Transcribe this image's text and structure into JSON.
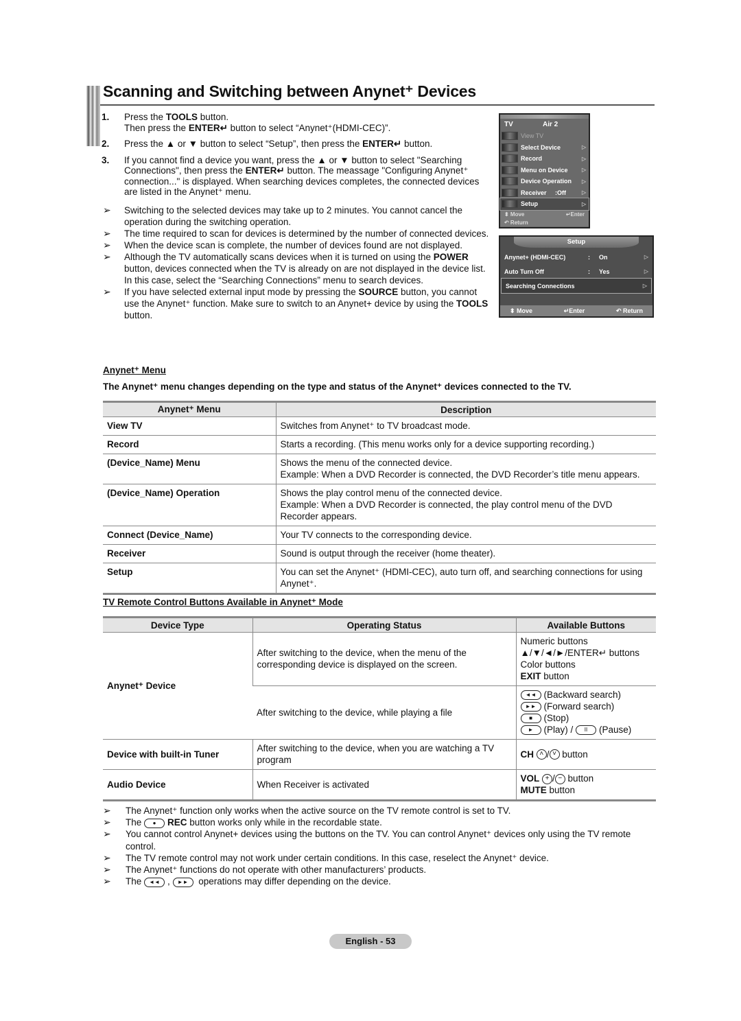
{
  "page": {
    "title": "Scanning and Switching between Anynet⁺ Devices",
    "page_number_label": "English - 53"
  },
  "steps": [
    {
      "num": "1.",
      "line1_pre": "Press the ",
      "line1_bold": "TOOLS",
      "line1_post": " button.",
      "line2_pre": "Then press the ",
      "line2_bold": "ENTER↵",
      "line2_post": " button to select “Anynet⁺(HDMI-CEC)”."
    },
    {
      "num": "2.",
      "pre": "Press the ▲ or ▼ button to select “Setup”, then press the ",
      "bold": "ENTER↵",
      "post": " button."
    },
    {
      "num": "3.",
      "pre": "If you cannot find a device you want, press the ▲ or ▼ button to select \"Searching Connections\", then press the ",
      "bold": "ENTER↵",
      "post": " button. The meassage \"Configuring Anynet⁺ connection...\" is displayed. When searching devices completes, the connected devices are listed in the Anynet⁺ menu."
    }
  ],
  "top_notes": [
    {
      "text": "Switching to the selected devices may take up to 2 minutes. You cannot cancel the operation during the switching operation."
    },
    {
      "text": "The time required to scan for devices is determined by the number of connected devices."
    },
    {
      "text": "When the device scan is complete, the number of devices found are not displayed."
    },
    {
      "pre": "Although the TV automatically scans devices when it is turned on using the ",
      "bold": "POWER",
      "post": " button, devices connected when the TV is already on are not displayed in the device list. In this case, select the “Searching Connections” menu to search devices."
    },
    {
      "pre": "If you have selected external input mode by pressing the ",
      "bold": "SOURCE",
      "post": " button, you cannot use the Anynet⁺ function. Make sure to switch to an Anynet+ device by using the ",
      "bold2": "TOOLS",
      "post2": " button."
    }
  ],
  "note_arrow": "➢",
  "osd_menu": {
    "source": "TV",
    "channel": "Air 2",
    "items": [
      {
        "label": "View TV",
        "dim": true
      },
      {
        "label": "Select Device"
      },
      {
        "label": "Record"
      },
      {
        "label": "Menu on Device"
      },
      {
        "label": "Device Operation"
      },
      {
        "label": "Receiver     :Off"
      },
      {
        "label": "Setup",
        "selected": true
      }
    ],
    "foot_move": "⬍ Move",
    "foot_enter": "↵Enter",
    "foot_return": "↶ Return"
  },
  "osd_setup": {
    "title": "Setup",
    "rows": [
      {
        "name": "Anynet+ (HDMI-CEC)",
        "colon": ":",
        "value": "On"
      },
      {
        "name": "Auto Turn Off",
        "colon": ":",
        "value": "Yes"
      },
      {
        "name": "Searching Connections",
        "colon": "",
        "value": "",
        "selected": true
      }
    ],
    "foot_move": "⬍ Move",
    "foot_enter": "↵Enter",
    "foot_return": "↶ Return"
  },
  "anynet_menu": {
    "heading": "Anynet⁺ Menu",
    "intro": "The Anynet⁺ menu changes depending on the type and status of the Anynet⁺ devices connected to the TV.",
    "columns": [
      "Anynet⁺ Menu",
      "Description"
    ],
    "rows": [
      {
        "menu": "View TV",
        "desc": [
          "Switches from Anynet⁺ to TV broadcast mode."
        ]
      },
      {
        "menu": "Record",
        "desc": [
          "Starts a recording. (This menu works only for a device supporting recording.)"
        ]
      },
      {
        "menu": "(Device_Name) Menu",
        "desc": [
          "Shows the menu of the connected device.",
          "Example: When a DVD Recorder is connected, the DVD Recorder’s title menu appears."
        ]
      },
      {
        "menu": "(Device_Name) Operation",
        "desc": [
          "Shows the play control menu of the connected device.",
          "Example: When a DVD Recorder is connected, the play control menu of the DVD Recorder appears."
        ]
      },
      {
        "menu": "Connect (Device_Name)",
        "desc": [
          "Your TV connects to the corresponding device."
        ]
      },
      {
        "menu": "Receiver",
        "desc": [
          "Sound is output through the receiver (home theater)."
        ]
      },
      {
        "menu": "Setup",
        "desc": [
          "You can set the Anynet⁺ (HDMI-CEC), auto turn off, and searching connections for using Anynet⁺."
        ]
      }
    ]
  },
  "remote_table": {
    "heading": "TV  Remote Control Buttons Available in Anynet⁺ Mode",
    "columns": [
      "Device Type",
      "Operating Status",
      "Available Buttons"
    ],
    "anynet_device": {
      "type": "Anynet⁺ Device",
      "status1": "After switching to the device, when the menu of the corresponding device is displayed on the screen.",
      "buttons1": [
        "Numeric buttons",
        "▲/▼/◄/►/ENTER↵ buttons",
        "Color buttons"
      ],
      "buttons1_exit_bold": "EXIT",
      "buttons1_exit_post": " button",
      "status2": "After switching to the device, while playing a file",
      "buttons2": [
        {
          "icon": "◄◄",
          "label": "(Backward search)"
        },
        {
          "icon": "►►",
          "label": "(Forward search)"
        },
        {
          "icon": "■",
          "label": "(Stop)"
        }
      ],
      "play_icon": "►",
      "play_label": "(Play) / ",
      "pause_icon": "II",
      "pause_label": "(Pause)"
    },
    "tuner": {
      "type": "Device with built-in Tuner",
      "status": "After switching to the device, when you are watching a TV program",
      "btn_bold": "CH",
      "up": "˄",
      "down": "˅",
      "btn_post": " button"
    },
    "audio": {
      "type": "Audio Device",
      "status": "When Receiver is activated",
      "vol_bold": "VOL",
      "plus": "+",
      "minus": "−",
      "vol_post": " button",
      "mute_bold": "MUTE",
      "mute_post": " button"
    }
  },
  "bottom_notes": [
    {
      "text": "The Anynet⁺ function only works when the active source on the TV remote control is set to TV."
    },
    {
      "pre": "The ",
      "icon": "●",
      "bold": "REC",
      "post": " button works only while in the recordable state."
    },
    {
      "text": "You cannot control Anynet+ devices using the buttons on the TV. You can control Anynet⁺ devices only using the TV remote control."
    },
    {
      "text": "The TV remote control may not work under certain conditions. In this case, reselect the Anynet⁺ device."
    },
    {
      "text": "The Anynet⁺ functions do not operate with other manufacturers’ products."
    },
    {
      "pre": "The ",
      "icon1": "◄◄",
      "mid": ", ",
      "icon2": "►►",
      "post": " operations may differ depending on the device."
    }
  ]
}
